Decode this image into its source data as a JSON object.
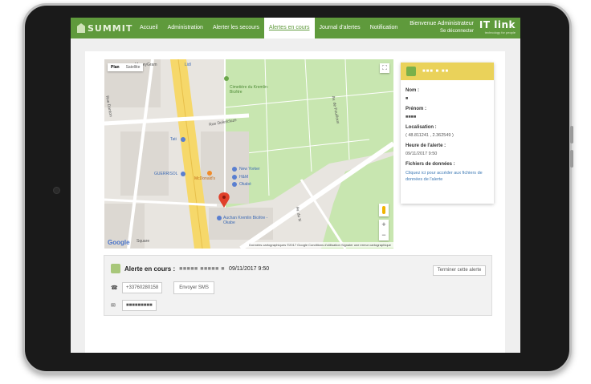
{
  "nav": {
    "logo_text": "SUMMIT",
    "items": [
      "Accueil",
      "Administration",
      "Alerter les secours",
      "Alertes en cours",
      "Journal d'alertes",
      "Notification"
    ],
    "active_index": 3,
    "welcome": "Bienvenue Administrateur",
    "logout": "Se déconnecter",
    "brand": "IT link",
    "brand_tag": "technology for people",
    "accent": "#5f9a3c"
  },
  "map": {
    "type_plan": "Plan",
    "type_satellite": "Satellite",
    "google": "Google",
    "attribution": "Données cartographiques ©2017 Google   Conditions d'utilisation   Signaler une erreur cartographique",
    "labels": {
      "moneygram": "MoneyGram",
      "lidl": "Lidl",
      "cimetiere": "Cimetière du Kremlin-Bicêtre",
      "rue_danton": "Rue Danton",
      "rue_delescluze": "Rue Delescluze",
      "tati": "Tati",
      "guerrisol": "GUERRISOL",
      "mcdonalds": "McDonald's",
      "new_yorker": "New Yorker",
      "hm": "H&M",
      "okabe": "Okabé",
      "auchan": "Auchan Kremlin Bicêtre - Okabe",
      "square": "Square",
      "av_de_fouilloux": "Av. de Fouilloux",
      "av_du_n": "Av. du N"
    },
    "zoom_in": "+",
    "zoom_out": "−"
  },
  "info": {
    "name": "■■■ ■ ■■",
    "nom_label": "Nom :",
    "nom_value": "■",
    "prenom_label": "Prénom :",
    "prenom_value": "■■■■",
    "loc_label": "Localisation :",
    "loc_value": "( 48.811241 , 2.362549 )",
    "heure_label": "Heure de l'alerte :",
    "heure_value": "09/11/2017 9:50",
    "files_label": "Fichiers de données :",
    "files_link": "Cliquez ici pour accéder aux fichiers de données de l'alerte"
  },
  "alert": {
    "label": "Alerte en cours :",
    "user": "■■■■■ ■■■■■ ■",
    "date": "09/11/2017 9:50",
    "end_button": "Terminer cette alerte",
    "phone": "+33760280158",
    "sms_button": "Envoyer SMS",
    "email": "■■■■■■■■■"
  }
}
